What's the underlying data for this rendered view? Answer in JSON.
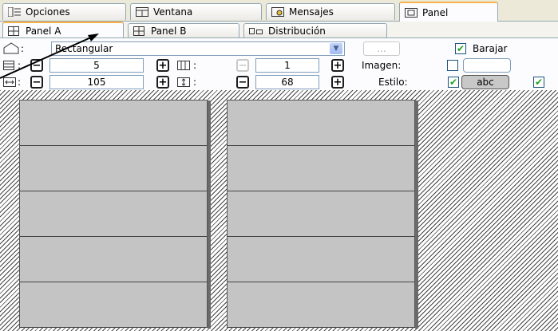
{
  "top_tabs": [
    {
      "label": "Opciones",
      "icon": "list-icon"
    },
    {
      "label": "Ventana",
      "icon": "window-icon"
    },
    {
      "label": "Mensajes",
      "icon": "messages-icon"
    },
    {
      "label": "Panel",
      "icon": "panel-icon"
    }
  ],
  "sub_tabs": [
    {
      "label": "Panel A",
      "icon": "grid-icon"
    },
    {
      "label": "Panel B",
      "icon": "grid-icon"
    },
    {
      "label": "Distribución",
      "icon": "layout-icon"
    }
  ],
  "controls": {
    "shape_value": "Rectangular",
    "browse_label": "...",
    "shuffle_label": "Barajar",
    "shuffle_checked": true,
    "rows_value": "5",
    "cols_value": "1",
    "image_label": "Imagen:",
    "image_checked": false,
    "width_value": "105",
    "height_value": "68",
    "style_label": "Estilo:",
    "style_checked": true,
    "style_sample": "abc",
    "colon": ":"
  },
  "colors": {
    "tab_accent": "#f7b34a",
    "check_green": "#21a121",
    "cell_fill": "#c4c4c4"
  }
}
